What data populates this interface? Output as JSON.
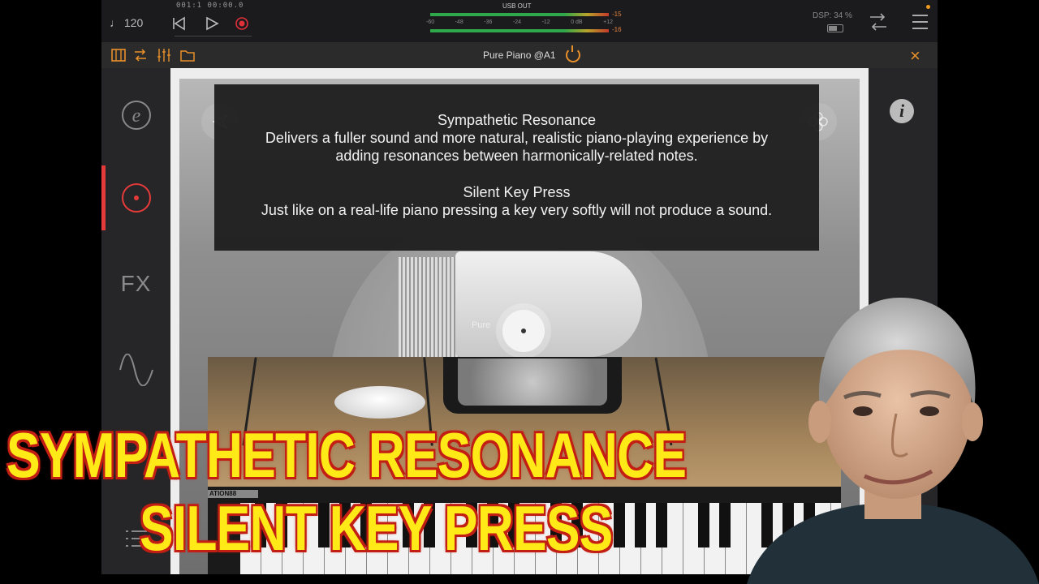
{
  "transport": {
    "tempo": "♩ 120",
    "counter": "001:1  00:00.0"
  },
  "meter": {
    "label": "USB OUT",
    "scale": [
      "-60",
      "-48",
      "-36",
      "-24",
      "-12",
      "0 dB",
      "+12"
    ],
    "peak_top": "-15",
    "peak_bottom": "-16"
  },
  "status": {
    "dsp": "DSP: 34 %"
  },
  "plugin": {
    "title": "Pure Piano @A1",
    "accent": "#e8902a"
  },
  "sidebar": {
    "items": [
      {
        "name": "effects-e-icon"
      },
      {
        "name": "instrument-icon",
        "active": true
      },
      {
        "label": "FX"
      },
      {
        "name": "waveform-icon"
      },
      {
        "name": "list-icon"
      }
    ]
  },
  "tooltip": {
    "heading1": "Sympathetic Resonance",
    "text1a": "Delivers a fuller sound and more natural, realistic piano-playing experience by",
    "text1b": "adding resonances between harmonically-related notes.",
    "heading2": "Silent Key Press",
    "text2": "Just like on a real-life piano pressing a key very softly will not produce a sound."
  },
  "instrument": {
    "preset_label": "Pure"
  },
  "overlay": {
    "headline1": "SYMPATHETIC RESONANCE",
    "headline2": "SILENT KEY PRESS",
    "text_color": "#ffea17",
    "outline_color": "#c21f14"
  },
  "webcam": {
    "keyboard_brand": "ATION88"
  }
}
